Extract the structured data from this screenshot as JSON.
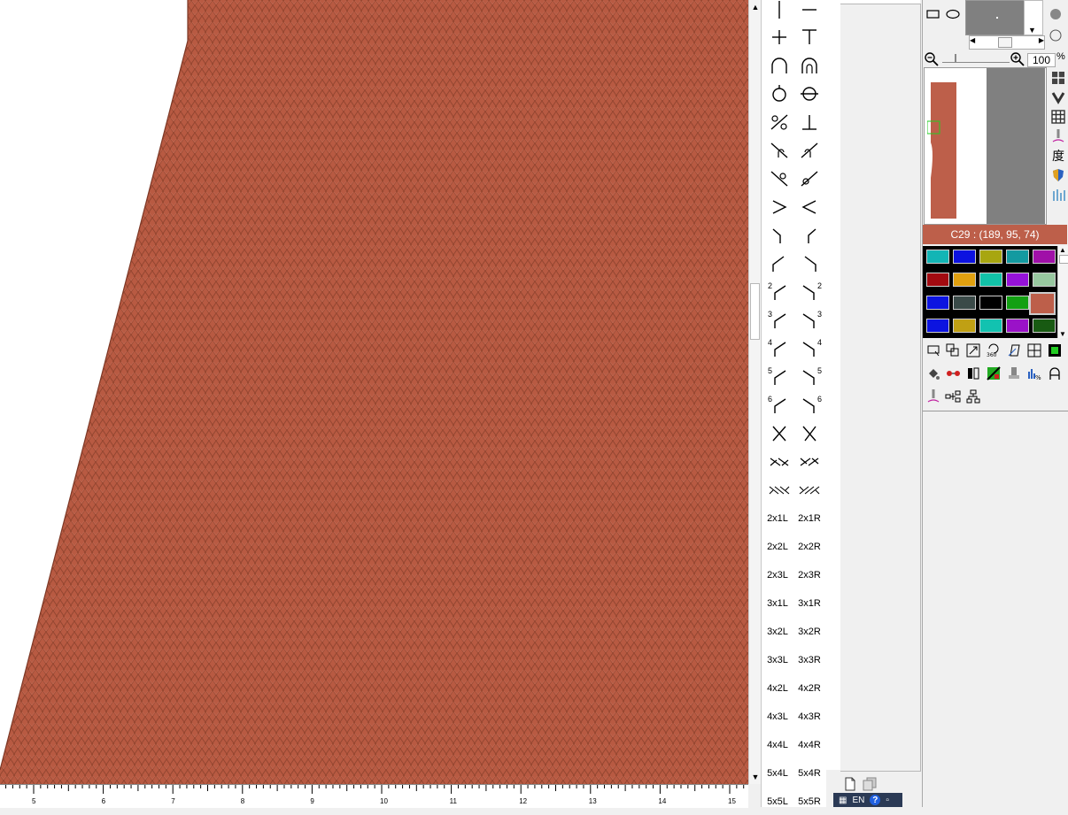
{
  "canvas": {
    "stitch_color": "#b85a42",
    "stitch_shade": "#8e3f2c",
    "background": "#ffffff"
  },
  "ruler": {
    "labels": [
      "5",
      "6",
      "7",
      "8",
      "9",
      "10",
      "11",
      "12",
      "13",
      "14",
      "15"
    ]
  },
  "symbols": {
    "cable_labels": [
      [
        "2x1L",
        "2x1R"
      ],
      [
        "2x2L",
        "2x2R"
      ],
      [
        "2x3L",
        "2x3R"
      ],
      [
        "3x1L",
        "3x1R"
      ],
      [
        "3x2L",
        "3x2R"
      ],
      [
        "3x3L",
        "3x3R"
      ],
      [
        "4x2L",
        "4x2R"
      ],
      [
        "4x3L",
        "4x3R"
      ],
      [
        "4x4L",
        "4x4R"
      ],
      [
        "5x4L",
        "5x4R"
      ],
      [
        "5x5L",
        "5x5R"
      ]
    ],
    "side_digits": [
      "2",
      "3",
      "4",
      "5",
      "6"
    ]
  },
  "zoom": {
    "value": "100",
    "unit": "%"
  },
  "current_color": {
    "label": "C29 : (189, 95, 74)",
    "hex": "#bd5f4a"
  },
  "palette": [
    [
      "#12b5b5",
      "#0c12e0",
      "#a8a610",
      "#139aa0",
      "#a010a8"
    ],
    [
      "#a20a10",
      "#e0a010",
      "#12c2a8",
      "#9612d8",
      "#98c8a0"
    ],
    [
      "#0c14e0",
      "#3a4a48",
      "#000000",
      "#12a012",
      "#bd5f4a"
    ],
    [
      "#0c14e0",
      "#c0a014",
      "#12c2b0",
      "#9a12c8",
      "#185a12"
    ]
  ],
  "side_tools": {
    "degree_char": "度"
  },
  "taskbar": {
    "lang": "EN",
    "help": "?"
  }
}
